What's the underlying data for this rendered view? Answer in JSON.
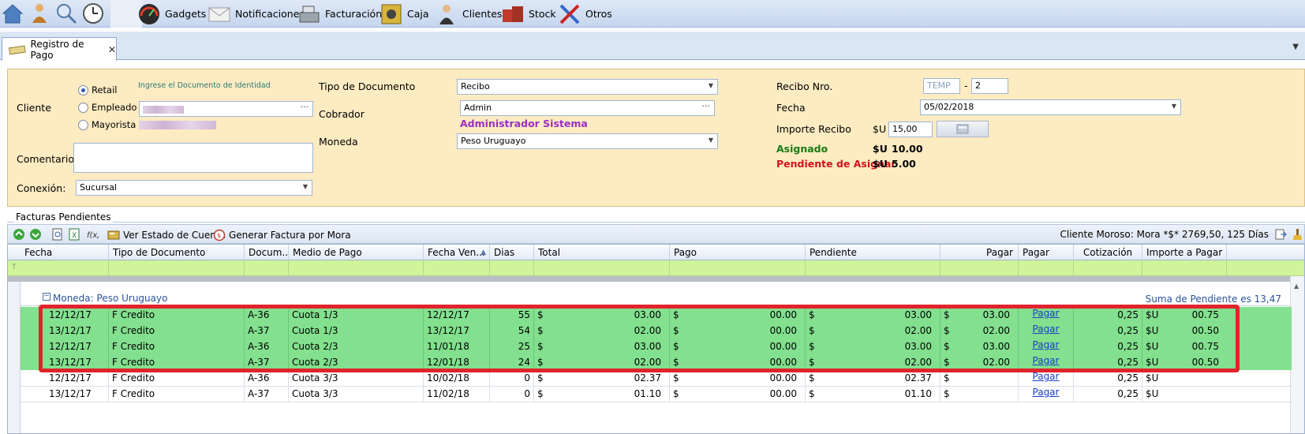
{
  "toolbar": {
    "items": [
      {
        "label": "Gadgets",
        "icon": "gauge-icon"
      },
      {
        "label": "Notificaciones",
        "icon": "envelope-icon"
      },
      {
        "label": "Facturación",
        "icon": "cash-register-icon"
      },
      {
        "label": "Caja",
        "icon": "safe-icon"
      },
      {
        "label": "Clientes",
        "icon": "person-icon"
      },
      {
        "label": "Stock",
        "icon": "boxes-icon"
      },
      {
        "label": "Otros",
        "icon": "tools-icon"
      }
    ]
  },
  "tab": {
    "title": "Registro de Pago",
    "close": "✕"
  },
  "form": {
    "cliente_label": "Cliente",
    "radio_retail": "Retail",
    "radio_empleado": "Empleado",
    "radio_mayorista": "Mayorista",
    "doc_hint": "Ingrese el Documento de Identidad",
    "comentarios_label": "Comentarios",
    "conexion_label": "Conexión:",
    "conexion_value": "Sucursal",
    "tipo_doc_label": "Tipo de Documento",
    "tipo_doc_value": "Recibo",
    "cobrador_label": "Cobrador",
    "cobrador_value": "Admin",
    "cobrador_name": "Administrador Sistema",
    "moneda_label": "Moneda",
    "moneda_value": "Peso Uruguayo",
    "recibo_label": "Recibo Nro.",
    "recibo_serie_placeholder": "TEMP",
    "recibo_dash": "-",
    "recibo_num": "2",
    "fecha_label": "Fecha",
    "fecha_value": "05/02/2018",
    "importe_label": "Importe Recibo",
    "importe_cur": "$U",
    "importe_value": "15,00",
    "asignado_label": "Asignado",
    "asignado_cur": "$U",
    "asignado_value": "10.00",
    "pendiente_label": "Pendiente de Asignar",
    "pendiente_cur": "$U",
    "pendiente_value": "5.00",
    "colors": {
      "asignado": "#1a7a12",
      "pendiente": "#d4141c",
      "cobrador_name": "#9a2fc4"
    }
  },
  "section": {
    "title": "Facturas Pendientes"
  },
  "grid_toolbar": {
    "ver_estado": "Ver Estado de Cuenta",
    "generar_factura": "Generar Factura por Mora",
    "moroso": "Cliente Moroso: Mora *$* 2769,50, 125 Días"
  },
  "grid": {
    "columns": [
      "Fecha",
      "Tipo de Documento",
      "Docum...",
      "Medio de Pago",
      "Fecha Ven...",
      "Dias",
      "Total",
      "Pago",
      "Pendiente",
      "Pagar",
      "Pagar",
      "Cotización",
      "Importe a Pagar"
    ],
    "group_label": "Moneda: Peso Uruguayo",
    "group_summary": "Suma de Pendiente es 13,47",
    "currency_symbol": "$",
    "pagar_link": "Pagar",
    "rows": [
      {
        "fecha": "12/12/17",
        "tipo": "F Credito",
        "doc": "A-36",
        "medio": "Cuota 1/3",
        "venc": "12/12/17",
        "dias": "55",
        "total": "03.00",
        "pago": "00.00",
        "pendiente": "03.00",
        "pagar": "03.00",
        "cotizacion": "0,25",
        "imp_cur": "$U",
        "importe": "00.75",
        "highlighted": true
      },
      {
        "fecha": "13/12/17",
        "tipo": "F Credito",
        "doc": "A-37",
        "medio": "Cuota 1/3",
        "venc": "13/12/17",
        "dias": "54",
        "total": "02.00",
        "pago": "00.00",
        "pendiente": "02.00",
        "pagar": "02.00",
        "cotizacion": "0,25",
        "imp_cur": "$U",
        "importe": "00.50",
        "highlighted": true
      },
      {
        "fecha": "12/12/17",
        "tipo": "F Credito",
        "doc": "A-36",
        "medio": "Cuota 2/3",
        "venc": "11/01/18",
        "dias": "25",
        "total": "03.00",
        "pago": "00.00",
        "pendiente": "03.00",
        "pagar": "03.00",
        "cotizacion": "0,25",
        "imp_cur": "$U",
        "importe": "00.75",
        "highlighted": true
      },
      {
        "fecha": "13/12/17",
        "tipo": "F Credito",
        "doc": "A-37",
        "medio": "Cuota 2/3",
        "venc": "12/01/18",
        "dias": "24",
        "total": "02.00",
        "pago": "00.00",
        "pendiente": "02.00",
        "pagar": "02.00",
        "cotizacion": "0,25",
        "imp_cur": "$U",
        "importe": "00.50",
        "highlighted": true
      },
      {
        "fecha": "12/12/17",
        "tipo": "F Credito",
        "doc": "A-36",
        "medio": "Cuota 3/3",
        "venc": "10/02/18",
        "dias": "0",
        "total": "02.37",
        "pago": "00.00",
        "pendiente": "02.37",
        "pagar": "",
        "cotizacion": "0,25",
        "imp_cur": "$U",
        "importe": "",
        "highlighted": false
      },
      {
        "fecha": "13/12/17",
        "tipo": "F Credito",
        "doc": "A-37",
        "medio": "Cuota 3/3",
        "venc": "11/02/18",
        "dias": "0",
        "total": "01.10",
        "pago": "00.00",
        "pendiente": "01.10",
        "pagar": "",
        "cotizacion": "0,25",
        "imp_cur": "$U",
        "importe": "",
        "highlighted": false
      }
    ]
  }
}
